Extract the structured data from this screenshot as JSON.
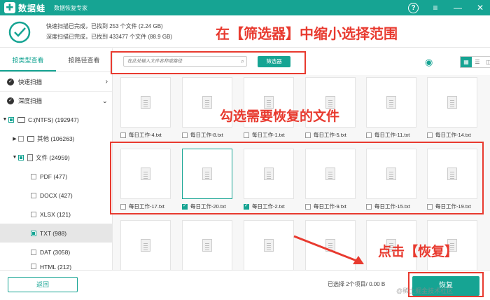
{
  "titlebar": {
    "logo_mark": "✚",
    "logo_text": "数据蛙",
    "subtitle": "数据恢复专家",
    "help": "?",
    "menu": "≡",
    "minimize": "—",
    "close": "✕"
  },
  "header": {
    "scan_quick": "快速扫描已完成，已找到 253 个文件 (2.24 GB)",
    "scan_deep": "深度扫描已完成，已找到 433477 个文件 (88.9 GB)"
  },
  "annotations": {
    "top": "在【筛选器】中缩小选择范围",
    "middle": "勾选需要恢复的文件",
    "bottom": "点击【恢复】"
  },
  "sidebar": {
    "tabs": [
      {
        "label": "按类型查看"
      },
      {
        "label": "按路径查看"
      }
    ],
    "quick_scan": "快速扫描",
    "deep_scan": "深度扫描",
    "drive": "C:(NTFS) (192947)",
    "other": "其他 (106263)",
    "files": "文件 (24959)",
    "items": [
      {
        "label": "PDF (477)"
      },
      {
        "label": "DOCX (427)"
      },
      {
        "label": "XLSX (121)"
      },
      {
        "label": "TXT (988)"
      },
      {
        "label": "DAT (3058)"
      },
      {
        "label": "HTML (212)"
      }
    ]
  },
  "toolbar": {
    "search_placeholder": "在此处输入文件名称或路径",
    "filter_label": "筛选器",
    "eye_icon": "◉",
    "view_grid": "▦",
    "view_list": "☰",
    "view_detail": "◫"
  },
  "files": {
    "row1": [
      "每日工作-4.txt",
      "每日工作-8.txt",
      "每日工作-1.txt",
      "每日工作-5.txt",
      "每日工作-11.txt",
      "每日工作-14.txt"
    ],
    "row2": [
      "每日工作-17.txt",
      "每日工作-20.txt",
      "每日工作-2.txt",
      "每日工作-9.txt",
      "每日工作-15.txt",
      "每日工作-19.txt"
    ]
  },
  "footer": {
    "back_label": "返回",
    "selected_info": "已选择 2个项目/ 0.00  B",
    "recover_label": "恢复",
    "watermark": "@稀土掘金技术社区"
  },
  "colors": {
    "accent": "#16a493",
    "annotation": "#e83a2f"
  }
}
